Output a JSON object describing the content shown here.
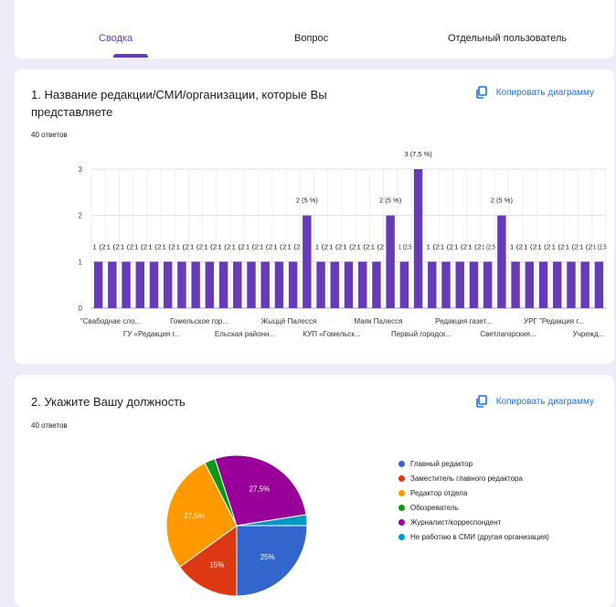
{
  "tabs": [
    {
      "label": "Сводка",
      "active": true
    },
    {
      "label": "Вопрос",
      "active": false
    },
    {
      "label": "Отдельный пользователь",
      "active": false
    }
  ],
  "accent_color": "#673ab7",
  "copy_label": "Копировать диаграмму",
  "copy_icon": "copy-icon",
  "question1": {
    "title": "1. Название редакции/СМИ/организации, которые Вы представляете",
    "responses": "40 ответов"
  },
  "question2": {
    "title": "2. Укажите Вашу должность",
    "responses": "40 ответов"
  },
  "chart_data": [
    {
      "type": "bar",
      "ylim": [
        0,
        3
      ],
      "yticks": [
        "0",
        "1",
        "2",
        "3"
      ],
      "grid": true,
      "bar_color": "#673ab7",
      "values": [
        1,
        1,
        1,
        1,
        1,
        1,
        1,
        1,
        1,
        1,
        1,
        1,
        1,
        1,
        1,
        2,
        1,
        1,
        1,
        1,
        1,
        2,
        1,
        3,
        1,
        1,
        1,
        1,
        1,
        2,
        1,
        1,
        1,
        1,
        1,
        1,
        1
      ],
      "value_labels": [
        "1 (2",
        "1 (2",
        "1 (2",
        "1 (2",
        "1 (2",
        "1 (2",
        "1 (2",
        "1 (2",
        "1 (2",
        "1 (2",
        "1 (2",
        "1 (2",
        "1 (2",
        "1 (2",
        "1 (2",
        "2 (5 %)",
        "1 (2",
        "1 (2",
        "1 (2",
        "1 (2",
        "1 (2",
        "2 (5 %)",
        "1 (2,5",
        "3 (7,5 %)",
        "1 (2",
        "1 (2",
        "1 (2",
        "1 (2",
        "1 (2,5",
        "2 (5 %)",
        "1 (2",
        "1 (2",
        "1 (2",
        "1 (2",
        "1 (2",
        "1 (2",
        "1 (2,5"
      ],
      "x_tick_labels_row1": [
        "\"Свабоднае сло...",
        "Гомельское гор...",
        "Жыццё Палесся",
        "Маяк Палесся",
        "Редакция газет...",
        "УРГ \"Редакция г..."
      ],
      "x_tick_labels_row2": [
        "ГУ «Редакция г...",
        "Ельская районн...",
        "КУП «Гомельск...",
        "Первый городск...",
        "Светлагорския...",
        "Учрежд..."
      ]
    },
    {
      "type": "pie",
      "slices": [
        {
          "name": "Главный редактор",
          "value": 25,
          "label": "25%",
          "color": "#3366cc"
        },
        {
          "name": "Заместитель главного редактора",
          "value": 15,
          "label": "15%",
          "color": "#dc3912"
        },
        {
          "name": "Редактор отдела",
          "value": 27.5,
          "label": "27,5%",
          "color": "#ff9900"
        },
        {
          "name": "Обозреватель",
          "value": 2.5,
          "label": "",
          "color": "#109618"
        },
        {
          "name": "Журналист/корреспондент",
          "value": 27.5,
          "label": "27,5%",
          "color": "#990099"
        },
        {
          "name": "Не работаю в СМИ (другая организация)",
          "value": 2.5,
          "label": "",
          "color": "#0099c6"
        }
      ]
    }
  ]
}
